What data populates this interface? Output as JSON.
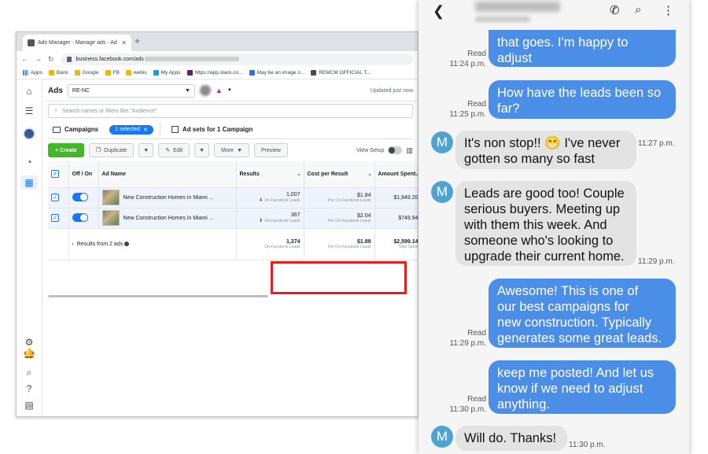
{
  "browser": {
    "tab_title": "Ads Manager - Manage ads - Ad",
    "url_prefix": "business.facebook.com/ads",
    "bookmarks": [
      "Apps",
      "Bank",
      "Google",
      "FB",
      "webis",
      "My Apps",
      "https://app.slack.co...",
      "May be an image o...",
      "REMCM OFFICIAL T..."
    ]
  },
  "ads_manager": {
    "title": "Ads",
    "account_label": "RE-NC",
    "updated_text": "Updated just now",
    "search_placeholder": "Search names or filters like \"Audience\"",
    "notification_badge": "99+",
    "tabs": {
      "campaigns": "Campaigns",
      "selected": "1 selected",
      "adsets": "Ad sets for 1 Campaign"
    },
    "toolbar": {
      "create": "+ Create",
      "duplicate": "Duplicate",
      "edit": "Edit",
      "more": "More",
      "preview": "Preview",
      "view_setup": "View Setup"
    },
    "columns": {
      "onoff": "Off / On",
      "ad_name": "Ad Name",
      "results": "Results",
      "cost": "Cost per Result",
      "amount": "Amount Spent"
    },
    "rows": [
      {
        "name": "New Construction Homes in Miami ...",
        "results": "1,007",
        "results_sub": "On-Facebook Leads",
        "cost": "$1.84",
        "cost_sub": "Per On-Facebook Leads",
        "amount": "$1,849.20"
      },
      {
        "name": "New Construction Homes in Miami ...",
        "results": "367",
        "results_sub": "On-Facebook Leads",
        "cost": "$2.04",
        "cost_sub": "Per On-Facebook Leads",
        "amount": "$749.94"
      }
    ],
    "summary": {
      "label": "Results from 2 ads",
      "results": "1,374",
      "results_sub": "On-Facebook Leads",
      "cost": "$1.89",
      "cost_sub": "Per On-Facebook Leads",
      "amount": "$2,599.14",
      "amount_sub": "Total Spent"
    }
  },
  "chat": {
    "avatar_letter": "M",
    "messages": [
      {
        "dir": "out",
        "lines": [
          "that goes. I'm happy to",
          "adjust"
        ],
        "status": "Read",
        "time": "11:24 p.m."
      },
      {
        "dir": "out",
        "lines": [
          "How have the leads been so",
          "far?"
        ],
        "status": "Read",
        "time": "11:25 p.m."
      },
      {
        "dir": "in",
        "lines": [
          "It's non stop!! 😁 I've never",
          "gotten so many so fast"
        ],
        "time": "11:27 p.m."
      },
      {
        "dir": "in",
        "lines": [
          "Leads are good too! Couple",
          "serious buyers. Meeting up",
          "with them this week. And",
          "someone who's looking to",
          "upgrade their current home."
        ],
        "time": "11:29 p.m."
      },
      {
        "dir": "out",
        "lines": [
          "Awesome! This is one of",
          "our best campaigns for",
          "new construction. Typically",
          "generates some great leads."
        ],
        "status": "Read",
        "time": "11:29 p.m."
      },
      {
        "dir": "out",
        "lines": [
          "keep me posted! And let us",
          "know if we need to adjust",
          "anything."
        ],
        "status": "Read",
        "time": "11:30 p.m."
      },
      {
        "dir": "in",
        "lines": [
          "Will do. Thanks!"
        ],
        "time": "11:30 p.m."
      }
    ]
  }
}
